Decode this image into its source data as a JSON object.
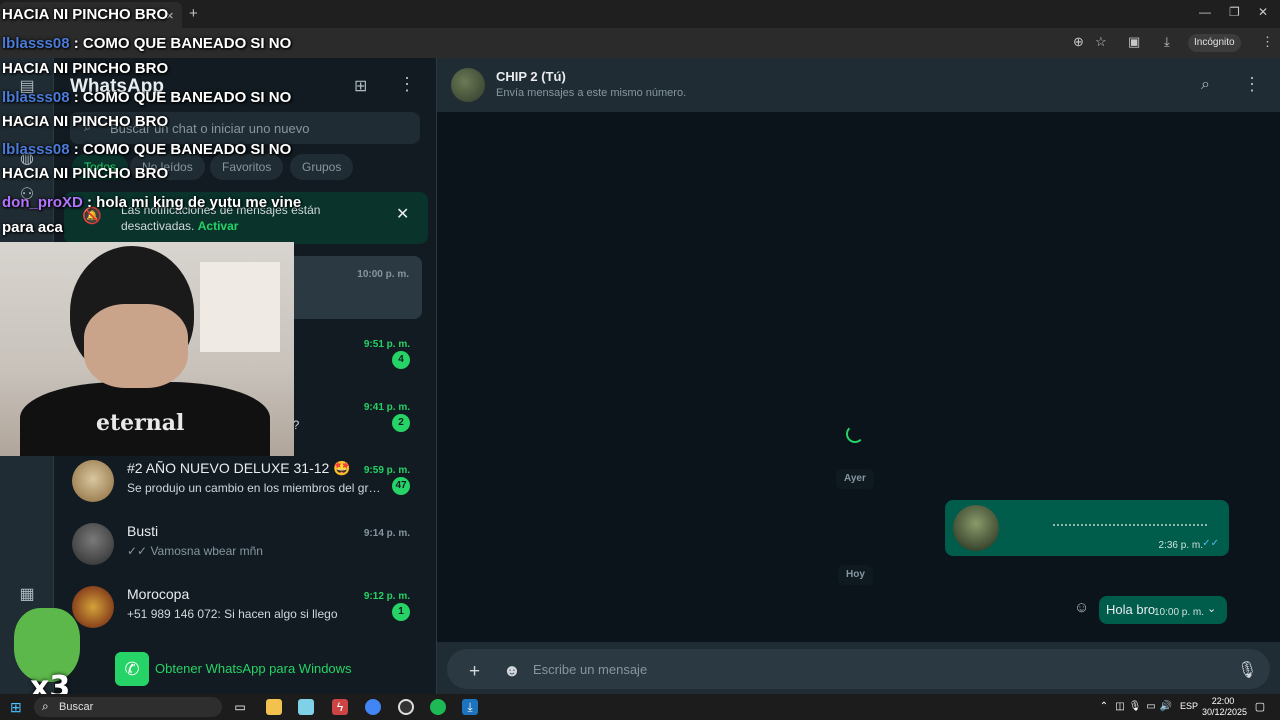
{
  "browser": {
    "tab_title": "HACIA NI PINCHO BRO",
    "tab_close": "×",
    "new_tab": "+",
    "incognito_label": "Incógnito"
  },
  "overlay": {
    "chat_lines": [
      {
        "user": "",
        "text": "HACIA NI PINCHO BRO"
      },
      {
        "user": "lblasss08",
        "text": ": COMO QUE BANEADO SI NO"
      },
      {
        "user": "",
        "text": "HACIA NI PINCHO BRO"
      },
      {
        "user": "lblasss08",
        "text": ": COMO QUE BANEADO SI NO"
      },
      {
        "user": "",
        "text": "HACIA NI PINCHO BRO"
      },
      {
        "user": "lblasss08",
        "text": ": COMO QUE BANEADO SI NO"
      },
      {
        "user": "",
        "text": "HACIA NI PINCHO BRO"
      },
      {
        "user": "don_proXD",
        "text": ": hola mi king de yutu me vine"
      },
      {
        "user": "",
        "text": "para aca"
      }
    ],
    "webcam_shirt": "eternal",
    "emote_label": "x3"
  },
  "sidebar": {
    "title": "WhatsApp",
    "search_placeholder": "Buscar un chat o iniciar uno nuevo",
    "filters": [
      "Todos",
      "No leídos",
      "Favoritos",
      "Grupos"
    ],
    "notification": {
      "text": "Las notificaciones de mensajes están desactivadas.",
      "link": "Activar"
    },
    "chats": [
      {
        "name": "",
        "preview": "",
        "time": "10:00 p. m.",
        "unread": ""
      },
      {
        "name": "",
        "preview": "",
        "time": "9:51 p. m.",
        "unread": "4"
      },
      {
        "name": "",
        "preview": "o?",
        "time": "9:41 p. m.",
        "unread": "2"
      },
      {
        "name": "#2 AÑO NUEVO DELUXE 31-12 🤩",
        "preview": "Se produjo un cambio en los miembros del grup...",
        "time": "9:59 p. m.",
        "unread": "47"
      },
      {
        "name": "Busti",
        "preview": "✓✓ Vamosna wbear mñn",
        "time": "9:14 p. m.",
        "unread": ""
      },
      {
        "name": "Morocopa",
        "preview": "+51 989 146 072: Si hacen algo si llego",
        "time": "9:12 p. m.",
        "unread": "1"
      }
    ],
    "get_app_label": "Obtener WhatsApp para Windows"
  },
  "conversation": {
    "name": "CHIP 2 (Tú)",
    "subtitle": "Envía mensajes a este mismo número.",
    "day_yesterday": "Ayer",
    "day_today": "Hoy",
    "image_msg_time": "2:36 p. m.",
    "text_msg": "Hola bro",
    "text_msg_time": "10:00 p. m.",
    "composer_placeholder": "Escribe un mensaje"
  },
  "taskbar": {
    "search_label": "Buscar",
    "lang": "ESP",
    "time": "22:00",
    "date": "30/12/2025"
  },
  "colors": {
    "accent": "#25d366",
    "panel": "#202c33",
    "background": "#111b21",
    "outgoing_bubble": "#005c4b"
  }
}
